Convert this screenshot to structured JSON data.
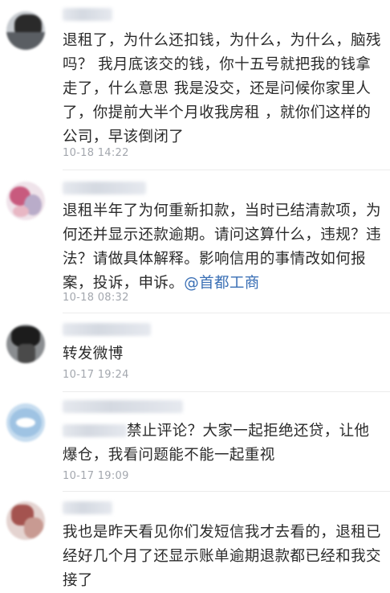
{
  "comments": [
    {
      "text": "退租了，为什么还扣钱，为什么，为什么，脑残吗？ 我月底该交的钱，你十五号就把我的钱拿走了，什么意思 我是没交，还是问候你家里人了，你提前大半个月收我房租 ，就你们这样的公司，早该倒闭了",
      "time": "10-18 14:22"
    },
    {
      "text": "退租半年了为何重新扣款，当时已结清款项，为何还并显示还款逾期。请问这算什么，违规？违法？请做具体解释。影响信用的事情改如何报案，投诉，申诉。",
      "mention": "@首都工商",
      "time": "10-18 08:32"
    },
    {
      "text": "转发微博",
      "time": "10-17 19:24"
    },
    {
      "text": "禁止评论？大家一起拒绝还贷，让他爆仓，我看问题能不能一起重视",
      "time": "10-17 19:09"
    },
    {
      "text": "我也是昨天看见你们发短信我才去看的，退租已经好几个月了还显示账单逾期退款都已经和我交接了"
    }
  ]
}
